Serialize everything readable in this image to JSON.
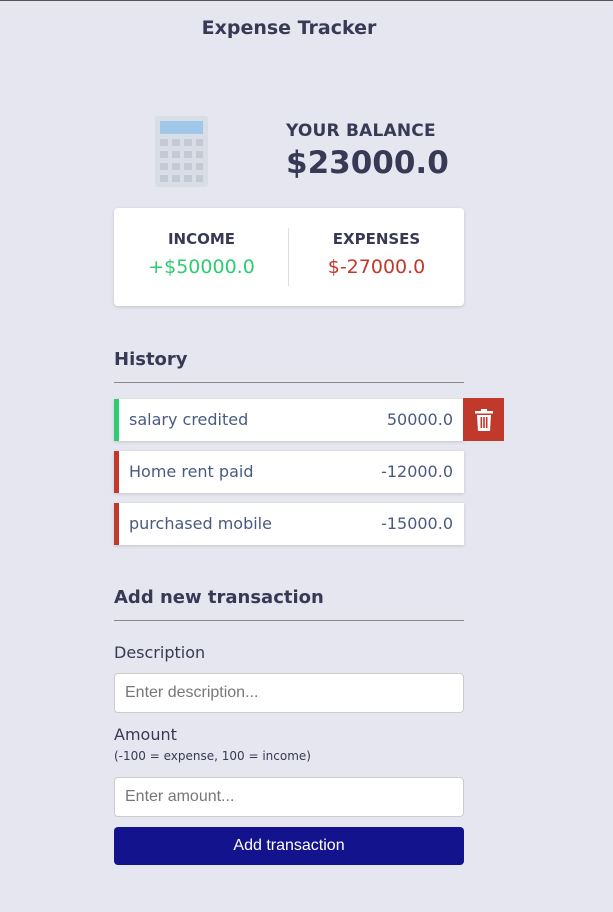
{
  "app": {
    "title": "Expense Tracker"
  },
  "balance": {
    "label": "YOUR BALANCE",
    "value": "$23000.0"
  },
  "summary": {
    "income_label": "INCOME",
    "income_value": "+$50000.0",
    "expense_label": "EXPENSES",
    "expense_value": "$-27000.0"
  },
  "history": {
    "title": "History",
    "items": [
      {
        "description": "salary credited",
        "amount": "50000.0",
        "type": "income"
      },
      {
        "description": "Home rent paid",
        "amount": "-12000.0",
        "type": "expense"
      },
      {
        "description": "purchased mobile",
        "amount": "-15000.0",
        "type": "expense"
      }
    ]
  },
  "form": {
    "title": "Add new transaction",
    "description_label": "Description",
    "description_placeholder": "Enter description...",
    "amount_label": "Amount",
    "amount_hint": "(-100 = expense, 100 = income)",
    "amount_placeholder": "Enter amount...",
    "submit_label": "Add transaction"
  },
  "colors": {
    "income": "#2ecc71",
    "expense": "#c0392b",
    "button": "#13138e",
    "background": "#e5e6ef"
  },
  "icons": {
    "hero": "calculator-icon",
    "delete": "trash-icon"
  }
}
